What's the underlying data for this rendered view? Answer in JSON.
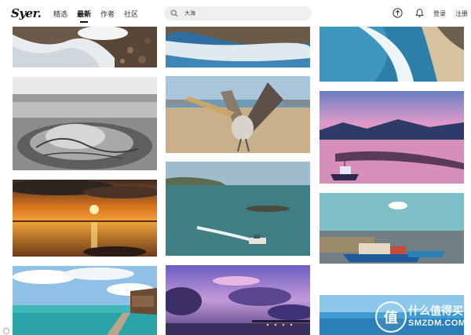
{
  "header": {
    "logo": "Syer.",
    "nav": [
      {
        "label": "精选",
        "active": false
      },
      {
        "label": "最新",
        "active": true
      },
      {
        "label": "作者",
        "active": false
      },
      {
        "label": "社区",
        "active": false
      }
    ],
    "search": {
      "value": "大海"
    },
    "upload_icon": "upload-arrow-icon",
    "bell_icon": "bell-icon",
    "login": "登录",
    "register": "注册"
  },
  "gallery": [
    {
      "name": "rocky-shore-wave",
      "theme": "shoes-rocks-wave"
    },
    {
      "name": "bw-jellyfish",
      "theme": "black-and-white-jellyfish"
    },
    {
      "name": "orange-sunset-sea",
      "theme": "sunset-over-sea"
    },
    {
      "name": "tropical-pier",
      "theme": "turquoise-lagoon-pier"
    },
    {
      "name": "waves-over-rocks",
      "theme": "long-exposure-waves"
    },
    {
      "name": "pelican-beach",
      "theme": "pelican-spreading-wings"
    },
    {
      "name": "speedboat-sea",
      "theme": "speedboat-wake"
    },
    {
      "name": "purple-sky-pier",
      "theme": "purple-clouds-pier-lights"
    },
    {
      "name": "aerial-surf",
      "theme": "aerial-surf-coast"
    },
    {
      "name": "pink-lake-boat",
      "theme": "pink-sunset-lake-boat"
    },
    {
      "name": "fishing-boats",
      "theme": "colorful-fishing-boats"
    },
    {
      "name": "blue-sea-bottom",
      "theme": "calm-blue-sea"
    }
  ],
  "watermark": {
    "icon": "值",
    "line1": "什么值得买",
    "line2": "SMZDM.COM"
  }
}
